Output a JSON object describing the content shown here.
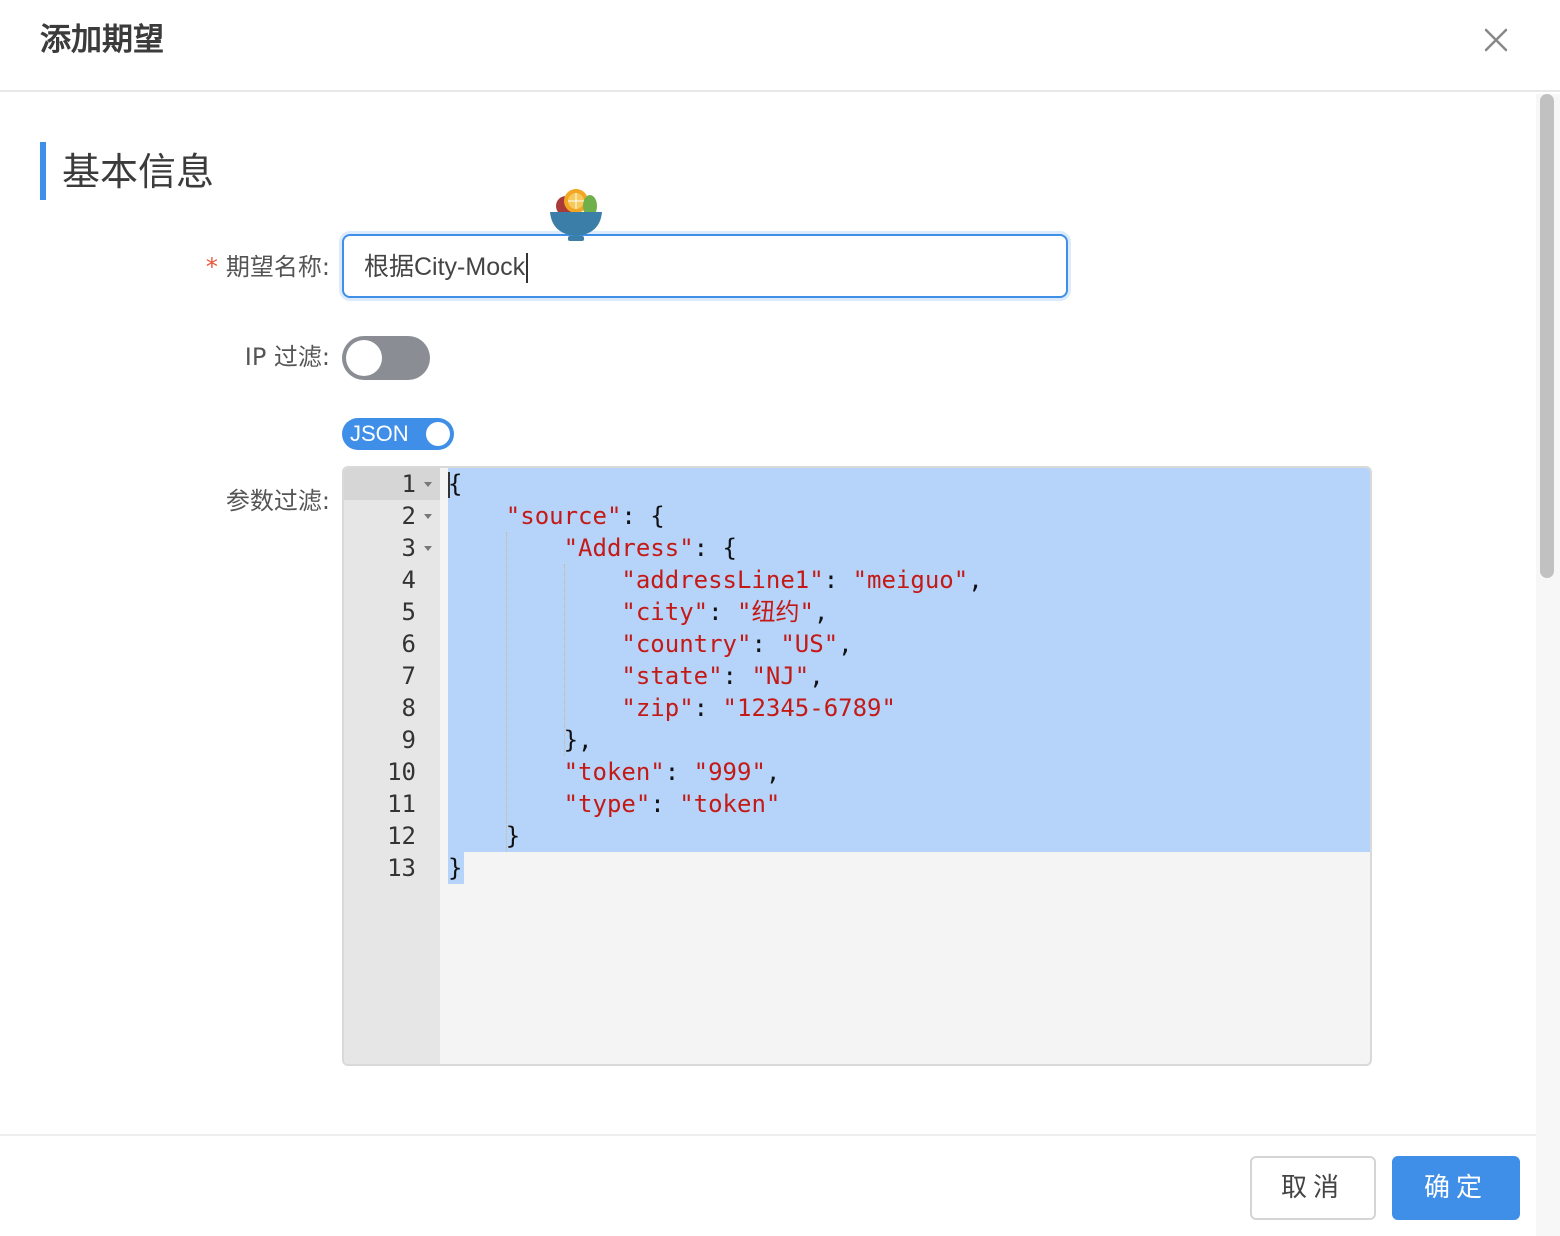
{
  "dialog": {
    "title": "添加期望",
    "close_icon": "close-icon"
  },
  "section": {
    "title": "基本信息"
  },
  "form": {
    "name": {
      "required_mark": "*",
      "label": "期望名称:",
      "value": "根据City-Mock"
    },
    "ip_filter": {
      "label": "IP 过滤:",
      "enabled": false
    },
    "json_toggle": {
      "label": "JSON",
      "enabled": true
    },
    "param_filter": {
      "label": "参数过滤:"
    },
    "floating_icon": "fruit-bowl-icon"
  },
  "editor": {
    "line_numbers": [
      "1",
      "2",
      "3",
      "4",
      "5",
      "6",
      "7",
      "8",
      "9",
      "10",
      "11",
      "12",
      "13"
    ],
    "foldable_lines": [
      1,
      2,
      3
    ],
    "selected_lines": "1-13",
    "lines": [
      {
        "indent": "",
        "parts": [
          {
            "t": "{",
            "c": "p"
          }
        ]
      },
      {
        "indent": "    ",
        "parts": [
          {
            "t": "\"source\"",
            "c": "k"
          },
          {
            "t": ": {",
            "c": "p"
          }
        ]
      },
      {
        "indent": "        ",
        "parts": [
          {
            "t": "\"Address\"",
            "c": "k"
          },
          {
            "t": ": {",
            "c": "p"
          }
        ]
      },
      {
        "indent": "            ",
        "parts": [
          {
            "t": "\"addressLine1\"",
            "c": "k"
          },
          {
            "t": ": ",
            "c": "p"
          },
          {
            "t": "\"meiguo\"",
            "c": "k"
          },
          {
            "t": ",",
            "c": "p"
          }
        ]
      },
      {
        "indent": "            ",
        "parts": [
          {
            "t": "\"city\"",
            "c": "k"
          },
          {
            "t": ": ",
            "c": "p"
          },
          {
            "t": "\"纽约\"",
            "c": "k"
          },
          {
            "t": ",",
            "c": "p"
          }
        ]
      },
      {
        "indent": "            ",
        "parts": [
          {
            "t": "\"country\"",
            "c": "k"
          },
          {
            "t": ": ",
            "c": "p"
          },
          {
            "t": "\"US\"",
            "c": "k"
          },
          {
            "t": ",",
            "c": "p"
          }
        ]
      },
      {
        "indent": "            ",
        "parts": [
          {
            "t": "\"state\"",
            "c": "k"
          },
          {
            "t": ": ",
            "c": "p"
          },
          {
            "t": "\"NJ\"",
            "c": "k"
          },
          {
            "t": ",",
            "c": "p"
          }
        ]
      },
      {
        "indent": "            ",
        "parts": [
          {
            "t": "\"zip\"",
            "c": "k"
          },
          {
            "t": ": ",
            "c": "p"
          },
          {
            "t": "\"12345-6789\"",
            "c": "k"
          }
        ]
      },
      {
        "indent": "        ",
        "parts": [
          {
            "t": "},",
            "c": "p"
          }
        ]
      },
      {
        "indent": "        ",
        "parts": [
          {
            "t": "\"token\"",
            "c": "k"
          },
          {
            "t": ": ",
            "c": "p"
          },
          {
            "t": "\"999\"",
            "c": "k"
          },
          {
            "t": ",",
            "c": "p"
          }
        ]
      },
      {
        "indent": "        ",
        "parts": [
          {
            "t": "\"type\"",
            "c": "k"
          },
          {
            "t": ": ",
            "c": "p"
          },
          {
            "t": "\"token\"",
            "c": "k"
          }
        ]
      },
      {
        "indent": "    ",
        "parts": [
          {
            "t": "}",
            "c": "p"
          }
        ]
      },
      {
        "indent": "",
        "parts": [
          {
            "t": "}",
            "c": "p"
          }
        ]
      }
    ]
  },
  "footer": {
    "cancel_label": "取消",
    "ok_label": "确定"
  },
  "colors": {
    "accent": "#3f8ee8",
    "required": "#e8563b",
    "json_string": "#c41a16",
    "selection": "#b6d3fa"
  }
}
